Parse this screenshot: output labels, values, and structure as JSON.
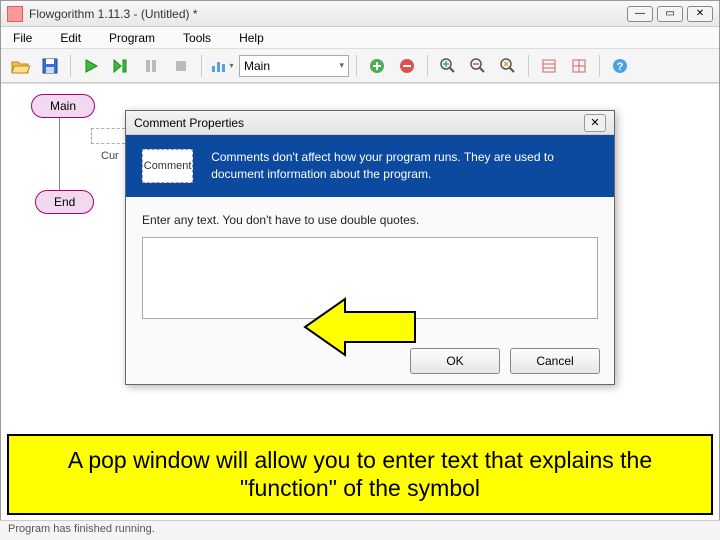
{
  "titlebar": {
    "text": "Flowgorithm 1.11.3 - (Untitled) *"
  },
  "menu": {
    "file": "File",
    "edit": "Edit",
    "program": "Program",
    "tools": "Tools",
    "help": "Help"
  },
  "toolbar": {
    "function_select": "Main"
  },
  "flowchart": {
    "main": "Main",
    "end": "End",
    "cur": "Cur"
  },
  "dialog": {
    "title": "Comment Properties",
    "icon_label": "Comment",
    "banner_text": "Comments don't affect how your program runs. They are used to document information about the program.",
    "hint": "Enter any text. You don't have to use double quotes.",
    "textarea_value": "",
    "ok": "OK",
    "cancel": "Cancel"
  },
  "caption": "A pop window will allow you to enter text that explains the \"function\" of the symbol",
  "statusbar": {
    "text": "Program has finished running."
  }
}
